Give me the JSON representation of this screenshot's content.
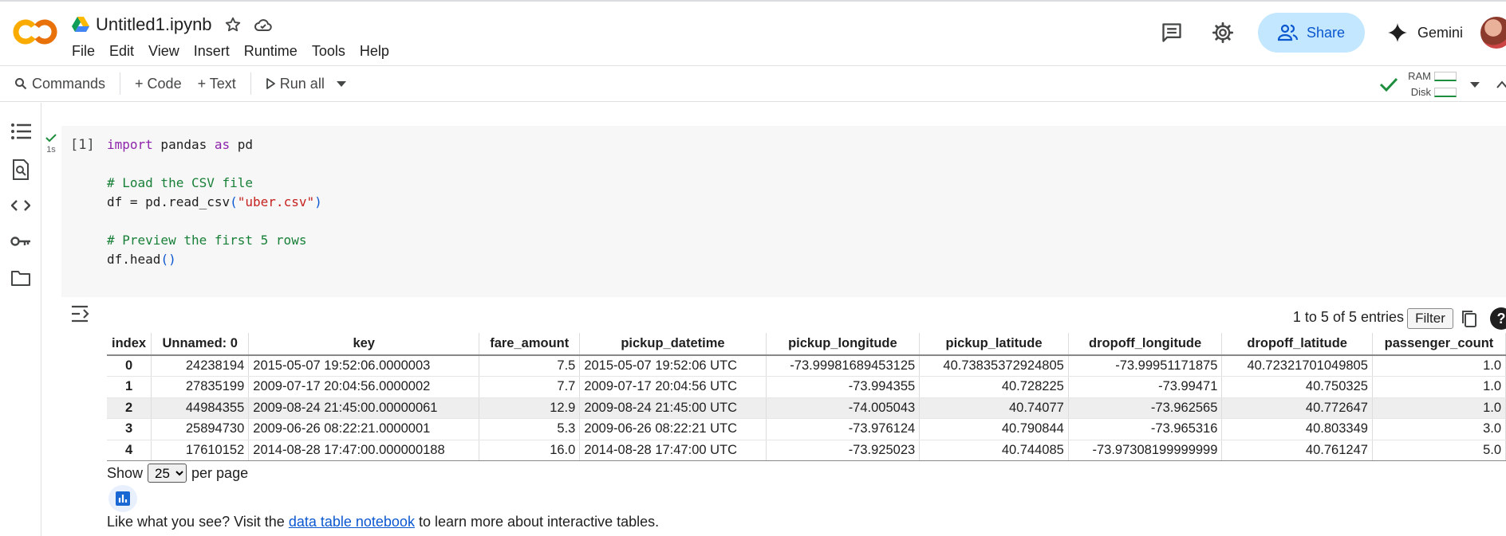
{
  "header": {
    "file_title": "Untitled1.ipynb",
    "menu": [
      "File",
      "Edit",
      "View",
      "Insert",
      "Runtime",
      "Tools",
      "Help"
    ],
    "share_label": "Share",
    "gemini_label": "Gemini"
  },
  "toolbar": {
    "commands_label": "Commands",
    "code_label": "+ Code",
    "text_label": "+ Text",
    "run_all_label": "Run all",
    "ram_label": "RAM",
    "disk_label": "Disk"
  },
  "cell": {
    "exec_count": "[1]",
    "run_time": "1s"
  },
  "output": {
    "entries_text": "1 to 5 of 5 entries",
    "filter_label": "Filter",
    "help_label": "?",
    "columns": [
      "index",
      "Unnamed: 0",
      "key",
      "fare_amount",
      "pickup_datetime",
      "pickup_longitude",
      "pickup_latitude",
      "dropoff_longitude",
      "dropoff_latitude",
      "passenger_count"
    ],
    "rows": [
      [
        "0",
        "24238194",
        "2015-05-07 19:52:06.0000003",
        "7.5",
        "2015-05-07 19:52:06 UTC",
        "-73.99981689453125",
        "40.73835372924805",
        "-73.99951171875",
        "40.72321701049805",
        "1.0"
      ],
      [
        "1",
        "27835199",
        "2009-07-17 20:04:56.0000002",
        "7.7",
        "2009-07-17 20:04:56 UTC",
        "-73.994355",
        "40.728225",
        "-73.99471",
        "40.750325",
        "1.0"
      ],
      [
        "2",
        "44984355",
        "2009-08-24 21:45:00.00000061",
        "12.9",
        "2009-08-24 21:45:00 UTC",
        "-74.005043",
        "40.74077",
        "-73.962565",
        "40.772647",
        "1.0"
      ],
      [
        "3",
        "25894730",
        "2009-06-26 08:22:21.0000001",
        "5.3",
        "2009-06-26 08:22:21 UTC",
        "-73.976124",
        "40.790844",
        "-73.965316",
        "40.803349",
        "3.0"
      ],
      [
        "4",
        "17610152",
        "2014-08-28 17:47:00.000000188",
        "16.0",
        "2014-08-28 17:47:00 UTC",
        "-73.925023",
        "40.744085",
        "-73.97308199999999",
        "40.761247",
        "5.0"
      ]
    ],
    "highlighted_row": 2,
    "show_label": "Show",
    "per_page_value": "25",
    "per_page_label": "per page",
    "like_prefix": "Like what you see? Visit the ",
    "like_link": "data table notebook",
    "like_suffix": " to learn more about interactive tables."
  },
  "colors": {
    "accent": "#0b57d0",
    "share_bg": "#c2e7ff",
    "success": "#1e8e3e",
    "logo_orange": "#f9ab00",
    "logo_dark_orange": "#e8710a"
  }
}
